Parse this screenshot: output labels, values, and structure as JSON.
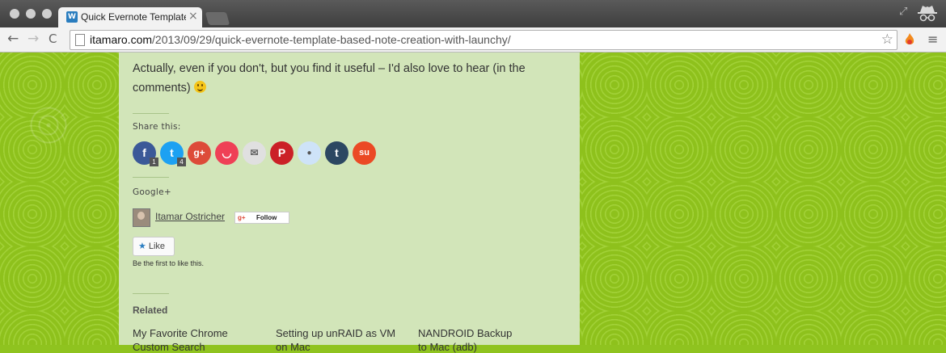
{
  "browser": {
    "tab_title": "Quick Evernote Template-",
    "tab_close": "×",
    "url_host": "itamaro.com",
    "url_path": "/2013/09/29/quick-evernote-template-based-note-creation-with-launchy/",
    "back": "←",
    "forward": "→",
    "reload": "C",
    "bookmark": "☆",
    "menu": "≡",
    "resize": "⤢"
  },
  "post": {
    "intro": "Actually, even if you don't, but you find it useful – I'd also love to hear (in the comments)"
  },
  "share": {
    "label": "Share this:",
    "buttons": [
      {
        "name": "facebook",
        "glyph": "f",
        "color": "#3b5998",
        "count": "1"
      },
      {
        "name": "twitter",
        "glyph": "t",
        "color": "#1da1f2",
        "count": "4"
      },
      {
        "name": "google-plus",
        "glyph": "g+",
        "color": "#dd4b39"
      },
      {
        "name": "pocket",
        "glyph": "◡",
        "color": "#ef4056"
      },
      {
        "name": "email",
        "glyph": "✉",
        "color": "#e0e0e0"
      },
      {
        "name": "pinterest",
        "glyph": "P",
        "color": "#cb2027"
      },
      {
        "name": "reddit",
        "glyph": "●",
        "color": "#cee3f8"
      },
      {
        "name": "tumblr",
        "glyph": "t",
        "color": "#2c4762"
      },
      {
        "name": "stumbleupon",
        "glyph": "su",
        "color": "#eb4924"
      }
    ]
  },
  "gplus": {
    "label": "Google+",
    "name": "Itamar Ostricher",
    "follow_g": "g+",
    "follow": "Follow"
  },
  "like": {
    "button": "Like",
    "star": "★",
    "first": "Be the first to like this."
  },
  "related": {
    "title": "Related",
    "items": [
      {
        "line1": "My Favorite Chrome",
        "line2": "Custom Search"
      },
      {
        "line1": "Setting up unRAID as VM",
        "line2": "on Mac"
      },
      {
        "line1": "NANDROID Backup",
        "line2": "to Mac (adb)"
      }
    ]
  }
}
